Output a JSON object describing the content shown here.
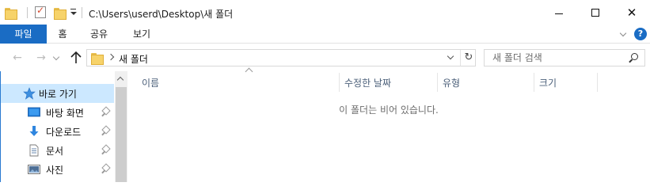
{
  "window": {
    "path_title": "C:\\Users\\userd\\Desktop\\새 폴더"
  },
  "ribbon": {
    "tabs": [
      "파일",
      "홈",
      "공유",
      "보기"
    ],
    "help_label": "?"
  },
  "navigation": {
    "breadcrumb_item": "새 폴더",
    "search_placeholder": "새 폴더 검색"
  },
  "sidebar": {
    "items": [
      {
        "label": "바로 가기",
        "icon": "star-icon"
      },
      {
        "label": "바탕 화면",
        "icon": "desktop-icon"
      },
      {
        "label": "다운로드",
        "icon": "download-icon"
      },
      {
        "label": "문서",
        "icon": "document-icon"
      },
      {
        "label": "사진",
        "icon": "pictures-icon"
      }
    ]
  },
  "file_list": {
    "columns": [
      "이름",
      "수정한 날짜",
      "유형",
      "크기"
    ],
    "empty_message": "이 폴더는 비어 있습니다."
  },
  "colors": {
    "accent": "#1a6cc4",
    "selected": "#cce8ff",
    "folder": "#f7d36a"
  }
}
